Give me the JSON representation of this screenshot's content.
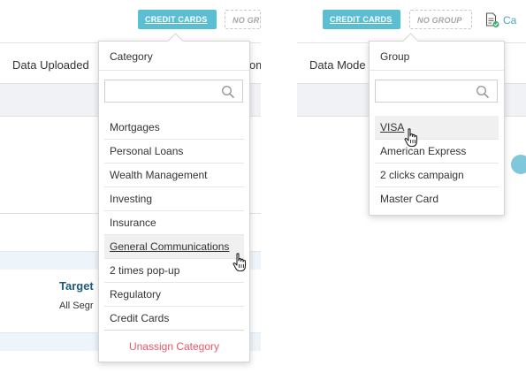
{
  "left_panel": {
    "toolbar": {
      "credit_cards_label": "CREDIT CARDS",
      "no_group_label": "NO GR"
    },
    "column_header": "Data Uploaded",
    "column_header_right": "om",
    "target_text": "Target",
    "segment_text": "All Segr",
    "dropdown": {
      "title": "Category",
      "search_placeholder": "",
      "items": [
        "Mortgages",
        "Personal Loans",
        "Wealth Management",
        "Investing",
        "Insurance",
        "General Communications",
        "2 times pop-up",
        "Regulatory",
        "Credit Cards"
      ],
      "unassign_label": "Unassign Category"
    }
  },
  "right_panel": {
    "toolbar": {
      "credit_cards_label": "CREDIT CARDS",
      "no_group_label": "NO GROUP",
      "cut_label": "Ca"
    },
    "column_header": "Data Mode",
    "dropdown": {
      "title": "Group",
      "search_placeholder": "",
      "items": [
        "VISA",
        "American Express",
        "2 clicks campaign",
        "Master Card"
      ]
    }
  },
  "colors": {
    "accent": "#5bbfd4",
    "unassign": "#e8576b",
    "target_heading": "#1f5a7d"
  },
  "icons": {
    "search": "search-icon",
    "cursor": "hand-pointer-icon",
    "doc": "document-check-icon"
  }
}
